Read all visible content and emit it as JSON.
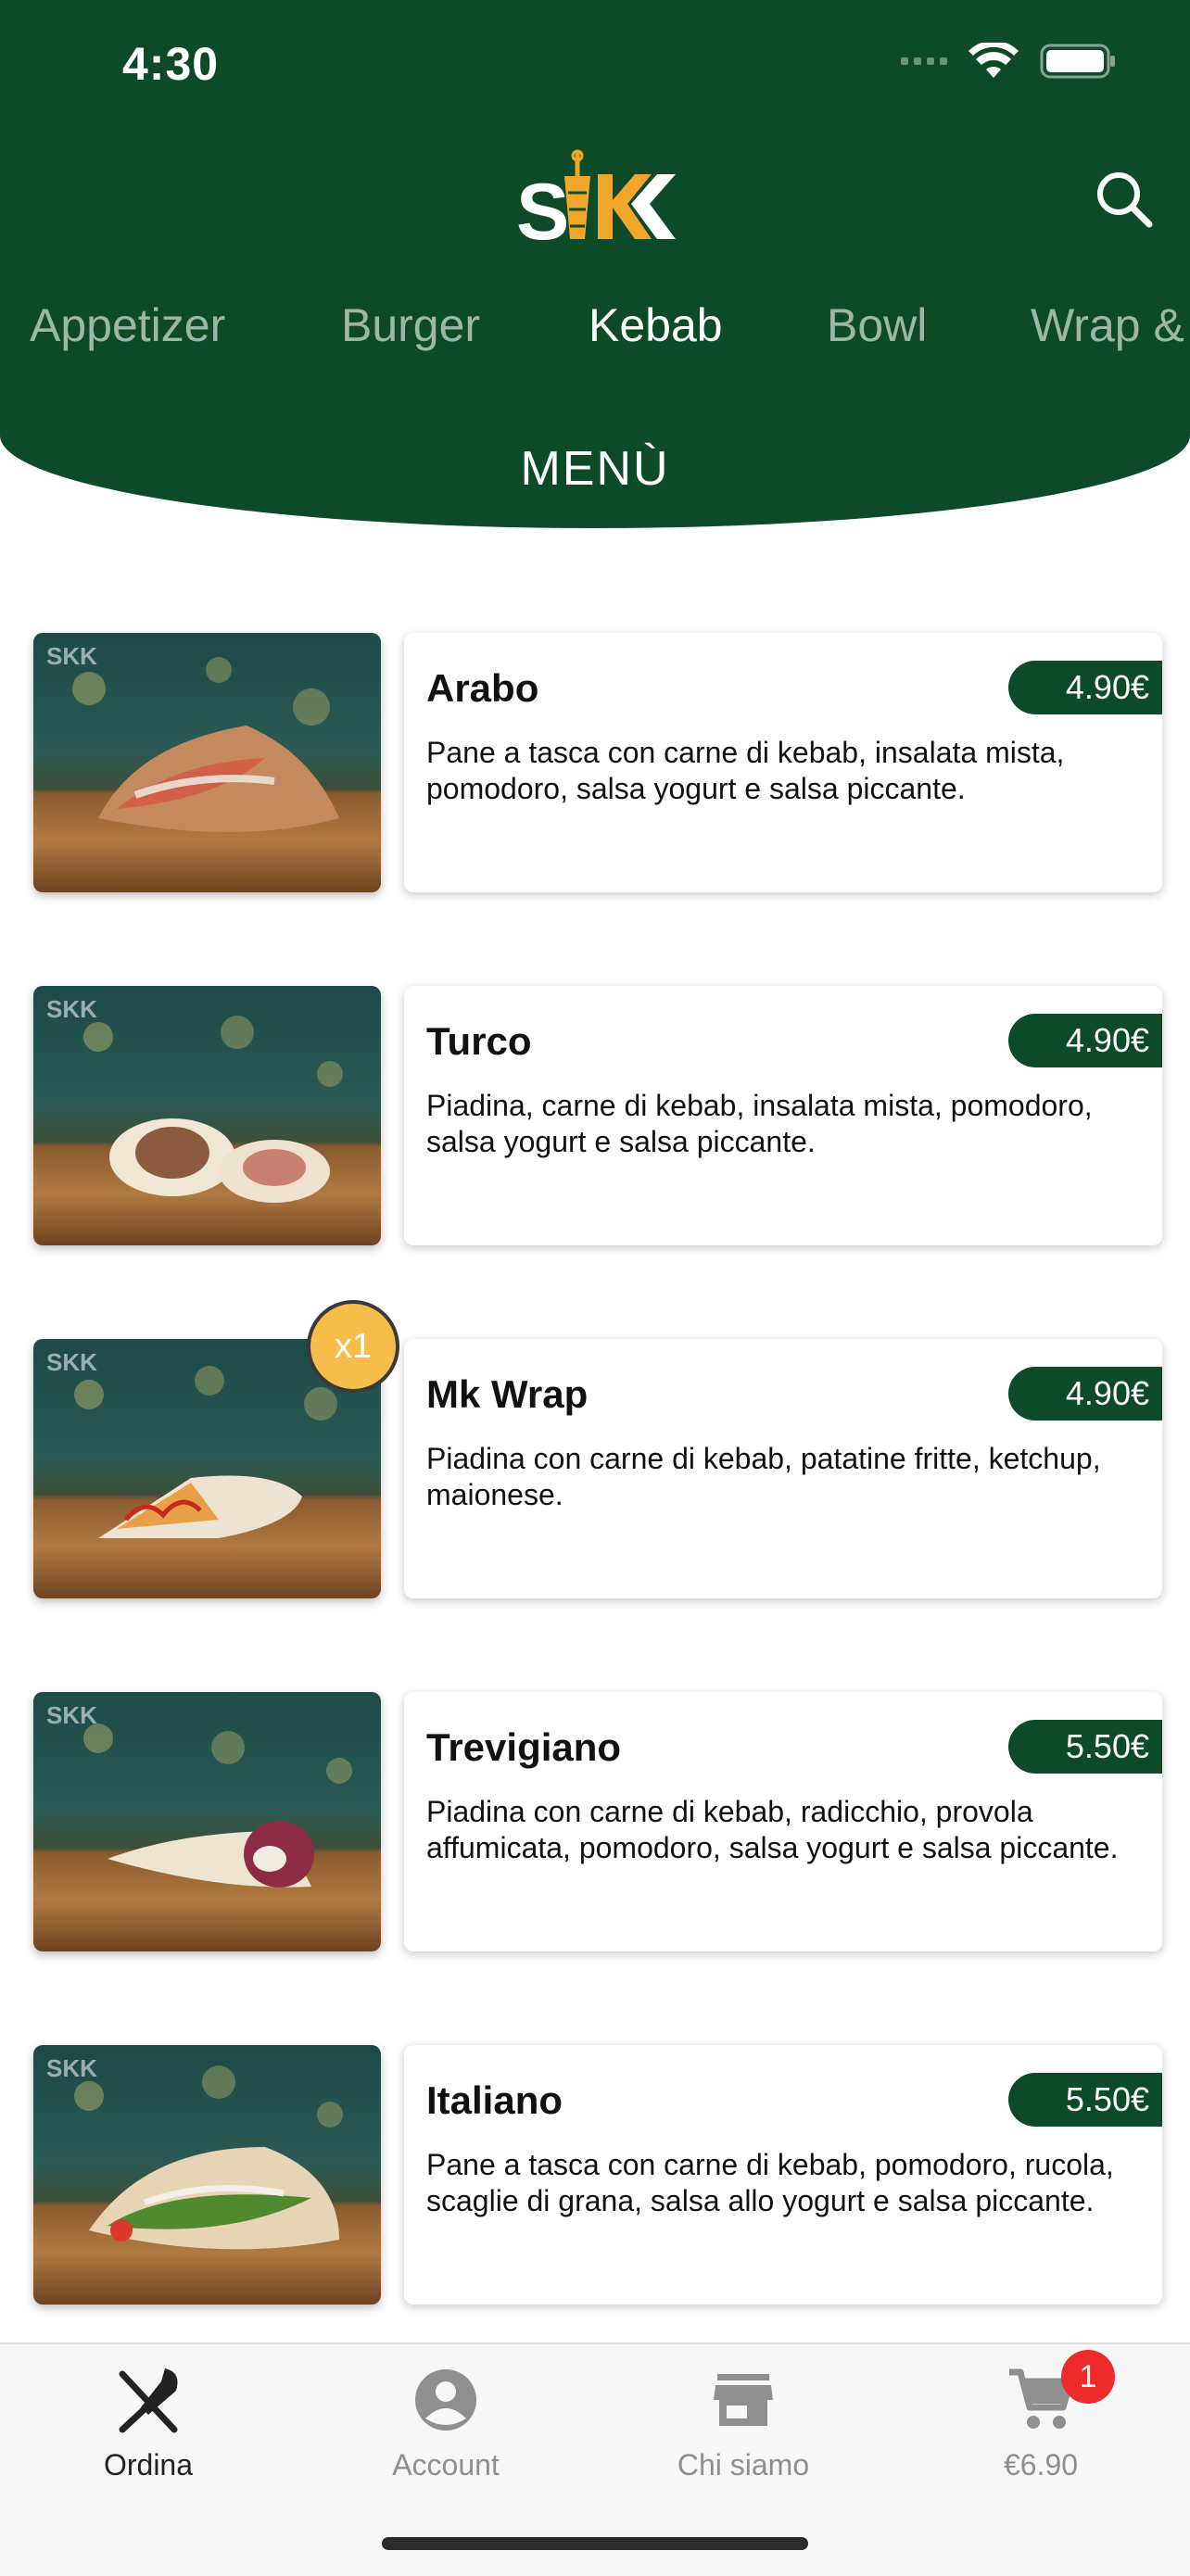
{
  "status": {
    "time": "4:30"
  },
  "header": {
    "logo_text": "SKK",
    "categories": [
      "Appetizer",
      "Burger",
      "Kebab",
      "Bowl",
      "Wrap &"
    ],
    "active_category": "Kebab",
    "menu_title": "MENÙ"
  },
  "items": [
    {
      "name": "Arabo",
      "price": "4.90€",
      "description": "Pane a tasca con carne di kebab, insalata mista, pomodoro, salsa yogurt e salsa piccante."
    },
    {
      "name": "Turco",
      "price": "4.90€",
      "description": "Piadina, carne di kebab, insalata mista, pomodoro, salsa yogurt e salsa piccante."
    },
    {
      "name": "Mk Wrap",
      "price": "4.90€",
      "description": "Piadina con carne di kebab, patatine fritte, ketchup, maionese.",
      "qty_badge": "x1"
    },
    {
      "name": "Trevigiano",
      "price": "5.50€",
      "description": "Piadina con carne di kebab, radicchio, provola affumicata, pomodoro, salsa yogurt e salsa piccante."
    },
    {
      "name": "Italiano",
      "price": "5.50€",
      "description": "Pane a tasca con carne di kebab, pomodoro, rucola, scaglie di grana, salsa allo yogurt e salsa piccante."
    }
  ],
  "bottom_nav": {
    "items": [
      {
        "label": "Ordina",
        "icon": "fork-knife-icon",
        "active": true
      },
      {
        "label": "Account",
        "icon": "account-icon",
        "active": false
      },
      {
        "label": "Chi siamo",
        "icon": "store-icon",
        "active": false
      },
      {
        "label": "€6.90",
        "icon": "cart-icon",
        "active": false,
        "badge": "1"
      }
    ]
  },
  "colors": {
    "brand_green": "#0d4a27",
    "logo_yellow": "#f2a72b",
    "badge_yellow": "#f6bd4a",
    "cart_badge_red": "#ef2a2a"
  }
}
